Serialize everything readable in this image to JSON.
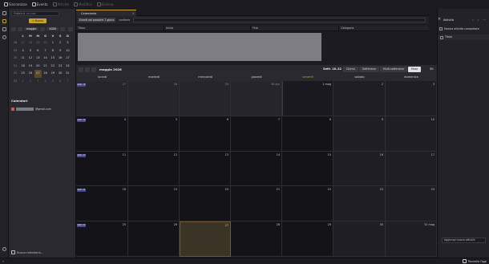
{
  "toolbar": {
    "items": [
      {
        "label": "Sincronizza",
        "enabled": true,
        "icon": "sync-icon"
      },
      {
        "label": "Evento",
        "enabled": true,
        "icon": "event-icon"
      },
      {
        "label": "Attività",
        "enabled": false,
        "icon": "task-icon"
      },
      {
        "label": "Modifica",
        "enabled": false,
        "icon": "edit-icon"
      },
      {
        "label": "Elimina",
        "enabled": false,
        "icon": "delete-icon"
      }
    ]
  },
  "sidebar": {
    "search_placeholder": "Pubblicit. un non",
    "new_event_label": "+ Nuovo evento",
    "mini_cal": {
      "month": "maggio",
      "year": "2026",
      "headers": [
        "",
        "L",
        "M",
        "M",
        "G",
        "V",
        "S",
        "D"
      ],
      "rows": [
        {
          "wk": "18",
          "days": [
            "27",
            "28",
            "29",
            "30",
            "1",
            "2",
            "3"
          ],
          "out": [
            0,
            1,
            2,
            3
          ]
        },
        {
          "wk": "19",
          "days": [
            "4",
            "5",
            "6",
            "7",
            "8",
            "9",
            "10"
          ],
          "out": []
        },
        {
          "wk": "20",
          "days": [
            "11",
            "12",
            "13",
            "14",
            "15",
            "16",
            "17"
          ],
          "out": []
        },
        {
          "wk": "21",
          "days": [
            "18",
            "19",
            "20",
            "21",
            "22",
            "23",
            "24"
          ],
          "out": []
        },
        {
          "wk": "22",
          "days": [
            "25",
            "26",
            "27",
            "28",
            "29",
            "30",
            "31"
          ],
          "out": []
        },
        {
          "wk": "23",
          "days": [
            "1",
            "2",
            "3",
            "4",
            "5",
            "6",
            "7"
          ],
          "out": [
            0,
            1,
            2,
            3,
            4,
            5,
            6
          ]
        }
      ],
      "selected": {
        "row": 4,
        "col": 2
      }
    },
    "calendars_title": "Calendari",
    "calendar_name_suffix": "@gmail.com",
    "new_calendar_label": "Nuovo calendario..."
  },
  "tab": {
    "label": "Calendario"
  },
  "filter": {
    "range_select": "Eventi nei prossimi 7 giorni",
    "contains_label": "contiene"
  },
  "list_columns": [
    "Titolo",
    "Inizio",
    "Fine",
    "Categoria"
  ],
  "calendar": {
    "title": "maggio 2026",
    "week_label": "Sett: 18–22",
    "views": [
      "Giorno",
      "Settimana",
      "Multi-settimana",
      "Mese"
    ],
    "active_view": "Mese",
    "side_number": "30",
    "weekdays": [
      "lunedì",
      "martedì",
      "mercoledì",
      "giovedì",
      "venerdì",
      "sabato",
      "domenica"
    ],
    "today_col": 4,
    "weeks": [
      {
        "badge": "Sett. 18",
        "days": [
          "27",
          "28",
          "29",
          "30 apr",
          "1 mag",
          "2",
          "3"
        ],
        "out": [
          0,
          1,
          2,
          3
        ]
      },
      {
        "badge": "Sett. 19",
        "days": [
          "4",
          "5",
          "6",
          "7",
          "8",
          "9",
          "10"
        ],
        "out": []
      },
      {
        "badge": "Sett. 20",
        "days": [
          "11",
          "12",
          "13",
          "14",
          "15",
          "16",
          "17"
        ],
        "out": []
      },
      {
        "badge": "Sett. 21",
        "days": [
          "18",
          "19",
          "20",
          "21",
          "22",
          "23",
          "24"
        ],
        "out": []
      },
      {
        "badge": "Sett. 22",
        "days": [
          "25",
          "26",
          "27",
          "28",
          "29",
          "30",
          "31 mag"
        ],
        "out": []
      }
    ],
    "selected": {
      "week": 4,
      "col": 2
    }
  },
  "taskpane": {
    "title": "Attività",
    "show_completed": "Mostra attività completate",
    "column_title": "Titolo",
    "add_placeholder": "Aggiungi nuova attività"
  },
  "status": {
    "today_pane": "Pannello Oggi"
  }
}
